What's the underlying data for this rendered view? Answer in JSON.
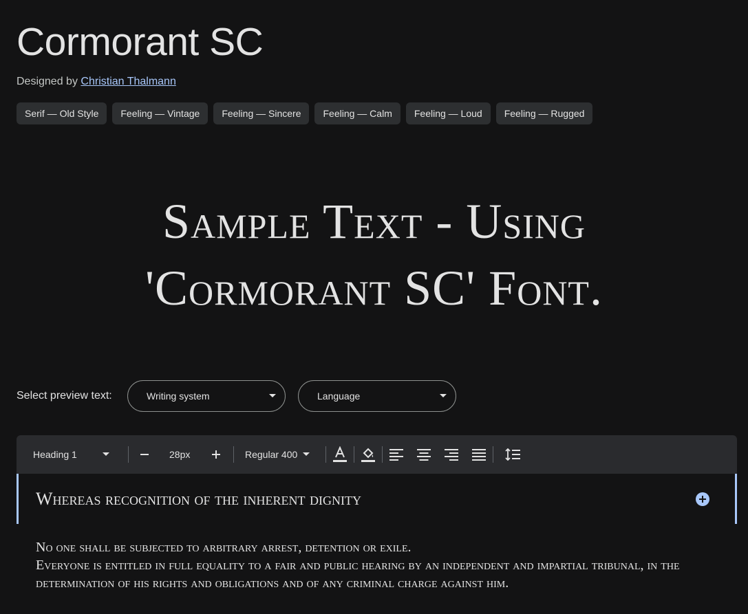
{
  "font": {
    "name": "Cormorant SC",
    "designed_by_label": "Designed by",
    "designer": "Christian Thalmann"
  },
  "tags": [
    "Serif — Old Style",
    "Feeling — Vintage",
    "Feeling — Sincere",
    "Feeling — Calm",
    "Feeling — Loud",
    "Feeling — Rugged"
  ],
  "sample": {
    "line1": "Sample Text - Using",
    "line2": "'Cormorant SC' Font."
  },
  "preview": {
    "label": "Select preview text:",
    "writing_system": "Writing system",
    "language": "Language"
  },
  "toolbar": {
    "style": "Heading 1",
    "size": "28px",
    "weight": "Regular 400"
  },
  "editor": {
    "heading": "Whereas recognition of the inherent dignity",
    "para1": "No one shall be subjected to arbitrary arrest, detention or exile.",
    "para2": "Everyone is entitled in full equality to a fair and public hearing by an independent and impartial tribunal, in the determination of his rights and obligations and of any criminal charge against him."
  },
  "colors": {
    "background": "#131314",
    "accent": "#a8c7fa",
    "chip": "#2d2f31"
  }
}
